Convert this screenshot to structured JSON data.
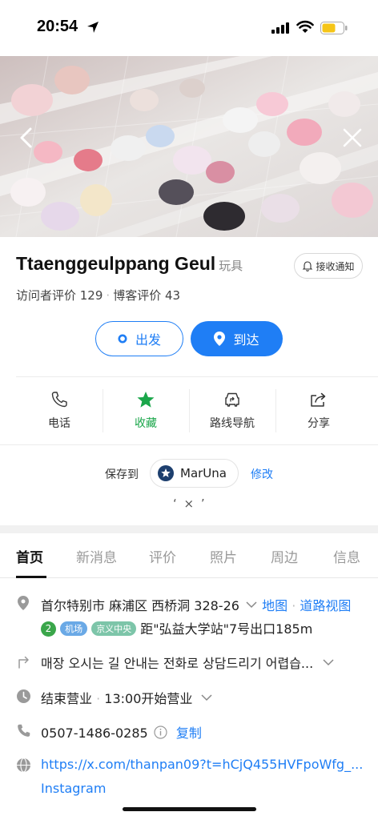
{
  "status_bar": {
    "time": "20:54"
  },
  "place": {
    "name": "Ttaenggeulppang Geul",
    "category": "玩具",
    "notify_label": "接收通知",
    "visitor_reviews": "访问者评价 129",
    "blog_reviews": "博客评价 43"
  },
  "route": {
    "depart_label": "出发",
    "arrive_label": "到达"
  },
  "actions": [
    {
      "label": "电话",
      "icon": "phone-icon"
    },
    {
      "label": "收藏",
      "icon": "star-icon"
    },
    {
      "label": "路线导航",
      "icon": "car-route-icon"
    },
    {
      "label": "分享",
      "icon": "share-icon"
    }
  ],
  "saved": {
    "label": "保存到",
    "list_name": "MarUna",
    "edit_label": "修改",
    "close_text": "‘ × ’"
  },
  "tabs": [
    "首页",
    "新消息",
    "评价",
    "照片",
    "周边",
    "信息"
  ],
  "info": {
    "address": "首尔特别市 麻浦区 西桥洞 328-26",
    "map_link": "地图",
    "road_view_link": "道路视图",
    "line_number": "2",
    "line_airport": "机场",
    "line_gyeongui": "京义中央",
    "station_distance": "距\"弘益大学站\"7号出口185m",
    "directions_note": "매장 오시는 길 안내는 전화로 상담드리기 어렵습...",
    "hours_status": "结束营业",
    "hours_next": "13:00开始营业",
    "phone": "0507-1486-0285",
    "copy_label": "复制",
    "website": "https://x.com/thanpan09?t=hCjQ455HVFpoWfg_...",
    "instagram": "Instagram"
  },
  "colors": {
    "accent_blue": "#1f7ef5",
    "favorite_green": "#1aa64a"
  }
}
